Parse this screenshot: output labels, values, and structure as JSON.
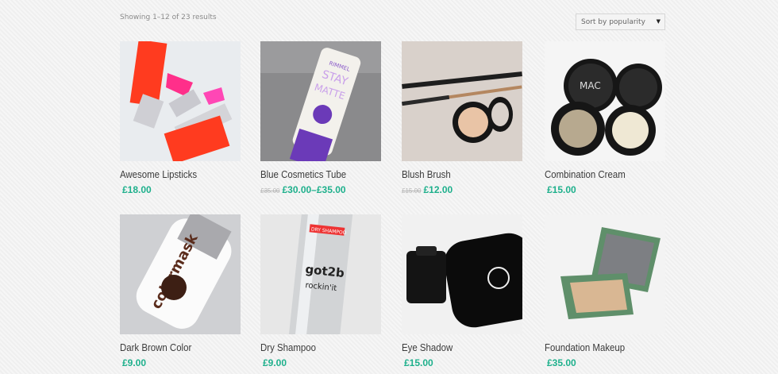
{
  "shop": {
    "result_count": "Showing 1–12 of 23 results",
    "ordering": {
      "selected": "Sort by popularity"
    }
  },
  "products": [
    {
      "title": "Awesome Lipsticks",
      "price": "£18.00",
      "old_price": ""
    },
    {
      "title": "Blue Cosmetics Tube",
      "price": "£30.00–£35.00",
      "old_price": "£35.00"
    },
    {
      "title": "Blush Brush",
      "price": "£12.00",
      "old_price": "£15.00"
    },
    {
      "title": "Combination Cream",
      "price": "£15.00",
      "old_price": ""
    },
    {
      "title": "Dark Brown Color",
      "price": "£9.00",
      "old_price": ""
    },
    {
      "title": "Dry Shampoo",
      "price": "£9.00",
      "old_price": ""
    },
    {
      "title": "Eye Shadow",
      "price": "£15.00",
      "old_price": ""
    },
    {
      "title": "Foundation Makeup",
      "price": "£35.00",
      "old_price": ""
    }
  ],
  "images": {
    "tube_brand": "RIMMEL",
    "tube_line1": "STAY",
    "tube_line2": "MATTE",
    "bottle_text": "colormask",
    "can_brand": "got2b",
    "can_sub": "rockin'it",
    "can_label": "DRY SHAMPOO",
    "compact_logo": "MAC"
  },
  "colors": {
    "price": "#1eb08c",
    "title": "#3b3b3b",
    "background": "#f2f2f2"
  }
}
